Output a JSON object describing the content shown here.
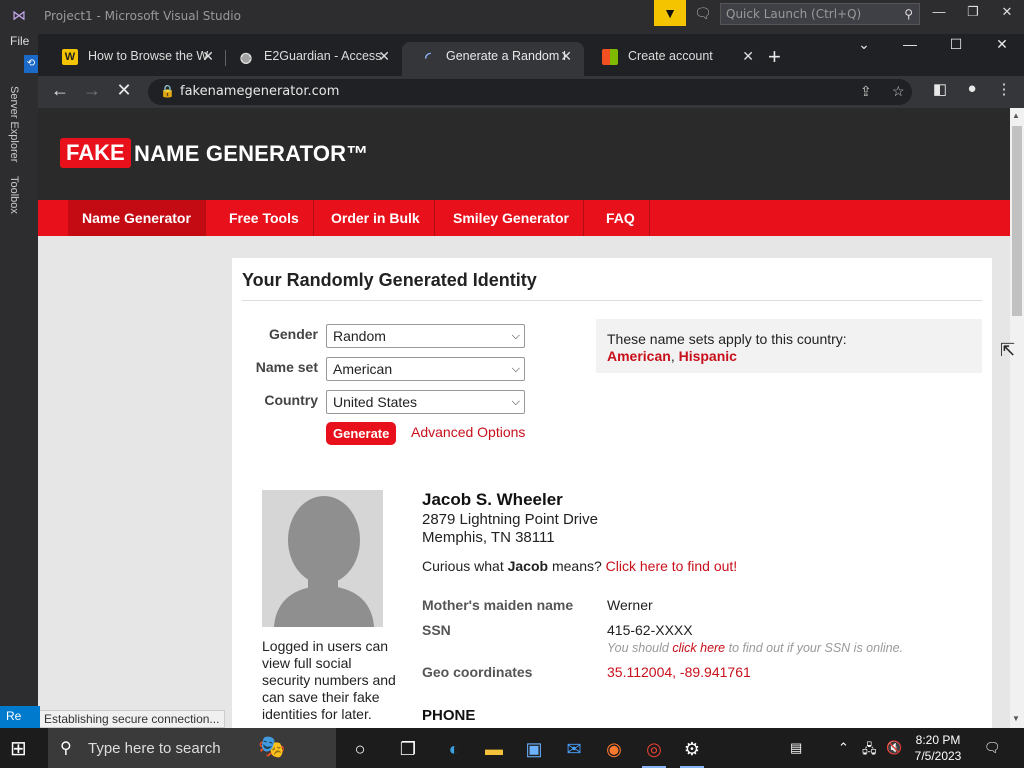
{
  "vs": {
    "title": "Project1 - Microsoft Visual Studio",
    "quick_launch": "Quick Launch (Ctrl+Q)",
    "menu_file": "File",
    "side_tabs": [
      "Server Explorer",
      "Toolbox"
    ],
    "bottom_status": "Re"
  },
  "browser": {
    "tabs": [
      {
        "title": "How to Browse the W",
        "favicon": "W"
      },
      {
        "title": "E2Guardian - Access",
        "favicon": "globe"
      },
      {
        "title": "Generate a Random I",
        "favicon": "spinner",
        "active": true
      },
      {
        "title": "Create account",
        "favicon": "microsoft"
      }
    ],
    "url": "fakenamegenerator.com",
    "status_text": "Establishing secure connection..."
  },
  "site": {
    "logo_fake": "FAKE",
    "logo_rest": "NAME GENERATOR™",
    "nav": [
      "Name Generator",
      "Free Tools",
      "Order in Bulk",
      "Smiley Generator",
      "FAQ"
    ],
    "heading": "Your Randomly Generated Identity",
    "form": {
      "gender_label": "Gender",
      "gender_value": "Random",
      "nameset_label": "Name set",
      "nameset_value": "American",
      "country_label": "Country",
      "country_value": "United States",
      "generate": "Generate",
      "advanced": "Advanced Options"
    },
    "country_box": {
      "text": "These name sets apply to this country:",
      "link1": "American",
      "comma": ",",
      "link2": "Hispanic"
    },
    "identity": {
      "name": "Jacob S. Wheeler",
      "street": "2879 Lightning Point Drive",
      "city": "Memphis, TN 38111",
      "curious_pre": "Curious what",
      "curious_name": "Jacob",
      "curious_mid": "means?",
      "curious_link": "Click here to find out!",
      "maiden_label": "Mother's maiden name",
      "maiden_value": "Werner",
      "ssn_label": "SSN",
      "ssn_value": "415-62-XXXX",
      "ssn_note_pre": "You should",
      "ssn_note_link": "click here",
      "ssn_note_post": "to find out if your SSN is online.",
      "geo_label": "Geo coordinates",
      "geo_value": "35.112004, -89.941761",
      "phone_heading": "PHONE"
    },
    "login_note": "Logged in users can view full social security numbers and can save their fake identities for later."
  },
  "taskbar": {
    "search_placeholder": "Type here to search",
    "time": "8:20 PM",
    "date": "7/5/2023"
  },
  "colors": {
    "brand_red": "#e8101b",
    "link_red": "#c8101b",
    "header_dark": "#2a2a2a"
  }
}
